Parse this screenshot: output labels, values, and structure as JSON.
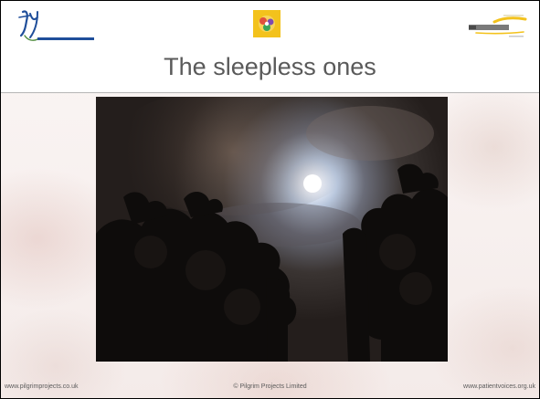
{
  "slide": {
    "title": "The sleepless ones",
    "photo_alt": "moon-behind-clouds-and-trees"
  },
  "logos": {
    "left": "pilgrim-projects-logo",
    "center": "flower-emblem-logo",
    "right": "patient-voices-logo"
  },
  "footer": {
    "left": "www.pilgrimprojects.co.uk",
    "center": "© Pilgrim Projects Limited",
    "right": "www.patientvoices.org.uk"
  },
  "colors": {
    "title": "#5a5a5a",
    "footer": "#5b5b5b",
    "logo_blue": "#1f4e9a",
    "logo_gold": "#f3c21c"
  }
}
